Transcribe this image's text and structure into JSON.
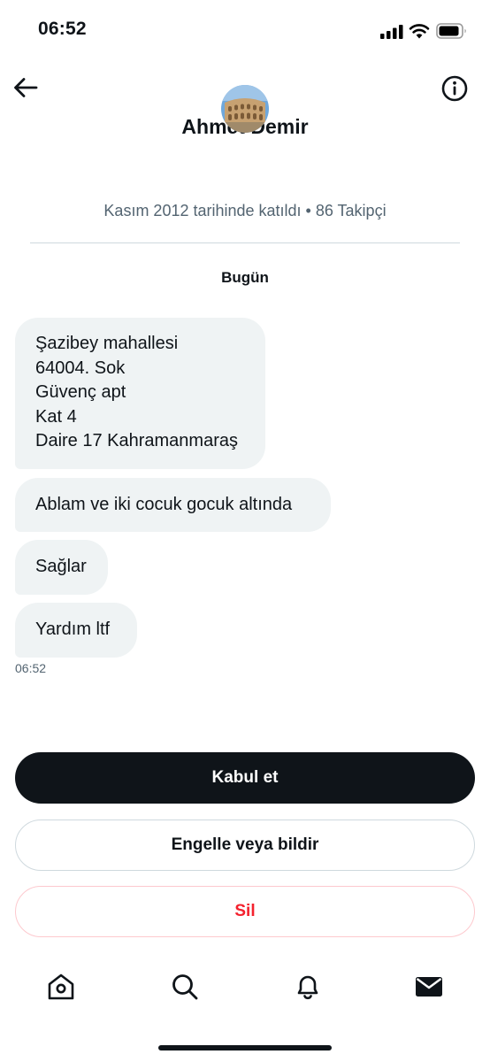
{
  "status_bar": {
    "time": "06:52"
  },
  "header": {
    "name": "Ahmet Demir",
    "meta": "Kasım 2012 tarihinde katıldı • 86 Takipçi"
  },
  "conversation": {
    "day_label": "Bugün",
    "message1_lines": [
      "Şazibey mahallesi",
      "64004. Sok",
      "Güvenç apt",
      "Kat 4",
      "Daire 17 Kahramanmaraş"
    ],
    "message2": "Ablam ve iki cocuk gocuk altında",
    "message3": "Sağlar",
    "message4": "Yardım ltf",
    "timestamp": "06:52"
  },
  "actions": {
    "accept": "Kabul et",
    "block_report": "Engelle veya bildir",
    "delete": "Sil"
  },
  "colors": {
    "accent_dark": "#0f1419",
    "bubble": "#eff3f4",
    "delete_red": "#f4212e",
    "muted": "#536471"
  },
  "icons": {
    "back": "arrow-left-icon",
    "info": "info-icon",
    "home": "home-icon",
    "search": "search-icon",
    "notifications": "bell-icon",
    "messages": "envelope-icon"
  }
}
